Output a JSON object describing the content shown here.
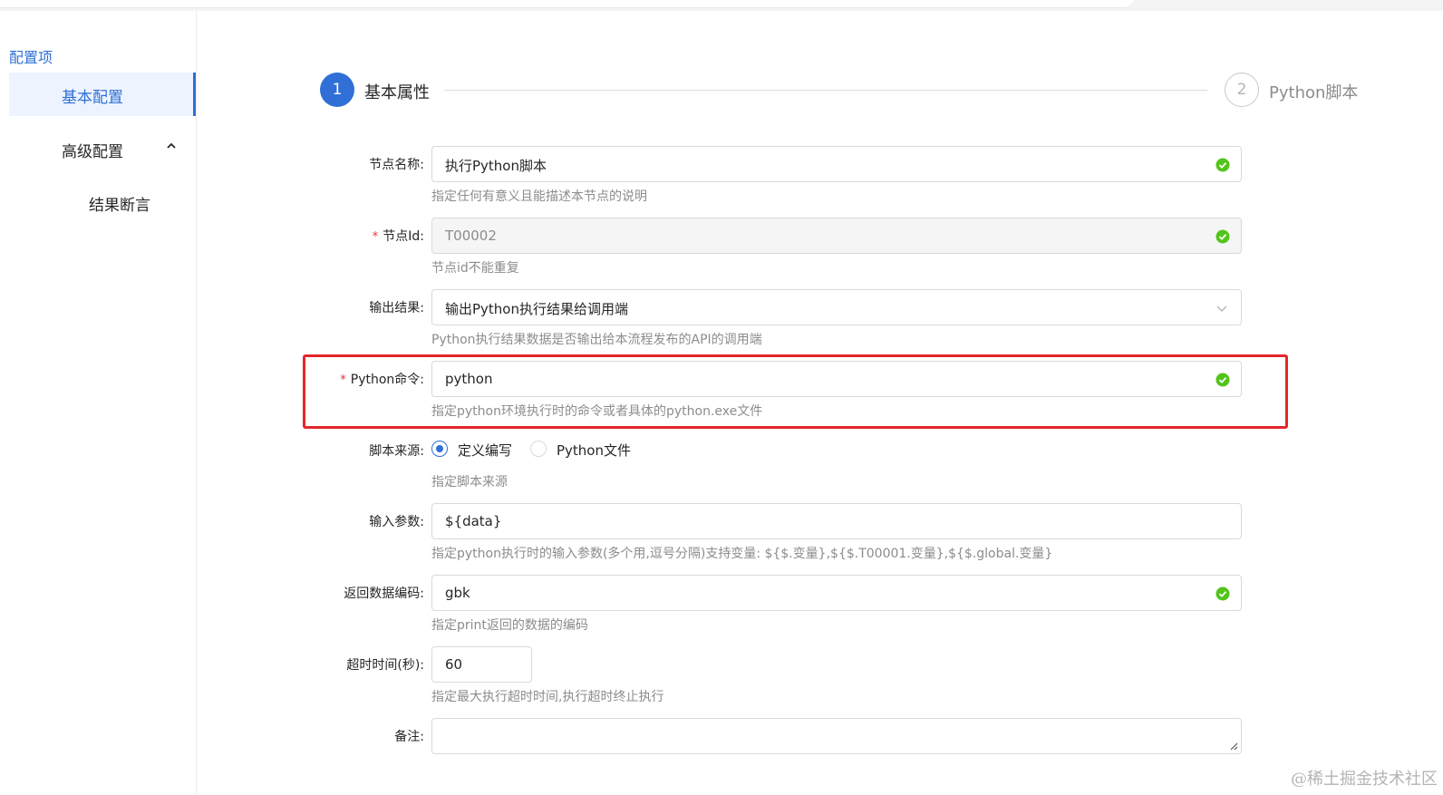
{
  "sidebar": {
    "title": "配置项",
    "items": [
      {
        "label": "基本配置"
      },
      {
        "label": "高级配置"
      },
      {
        "label": "结果断言"
      }
    ]
  },
  "steps": [
    {
      "number": "1",
      "title": "基本属性"
    },
    {
      "number": "2",
      "title": "Python脚本"
    }
  ],
  "form": {
    "node_name": {
      "label": "节点名称:",
      "value": "执行Python脚本",
      "help": "指定任何有意义且能描述本节点的说明"
    },
    "node_id": {
      "required": "*",
      "label": "节点Id:",
      "value": "T00002",
      "help": "节点id不能重复"
    },
    "output_result": {
      "label": "输出结果:",
      "value": "输出Python执行结果给调用端",
      "help": "Python执行结果数据是否输出给本流程发布的API的调用端"
    },
    "python_cmd": {
      "required": "*",
      "label": "Python命令:",
      "value": "python",
      "help": "指定python环境执行时的命令或者具体的python.exe文件"
    },
    "script_source": {
      "label": "脚本来源:",
      "options": [
        "定义编写",
        "Python文件"
      ],
      "selected": "定义编写",
      "help": "指定脚本来源"
    },
    "input_params": {
      "label": "输入参数:",
      "value": "${data}",
      "help": "指定python执行时的输入参数(多个用,逗号分隔)支持变量: ${$.变量},${$.T00001.变量},${$.global.变量}"
    },
    "return_encoding": {
      "label": "返回数据编码:",
      "value": "gbk",
      "help": "指定print返回的数据的编码"
    },
    "timeout": {
      "label": "超时时间(秒):",
      "value": "60",
      "help": "指定最大执行超时时间,执行超时终止执行"
    },
    "remark": {
      "label": "备注:",
      "value": ""
    }
  },
  "watermark": "@稀土掘金技术社区",
  "colors": {
    "primary": "#2f6fd6",
    "success": "#52c41a",
    "highlight": "#e3262a",
    "required": "#ee3333"
  }
}
